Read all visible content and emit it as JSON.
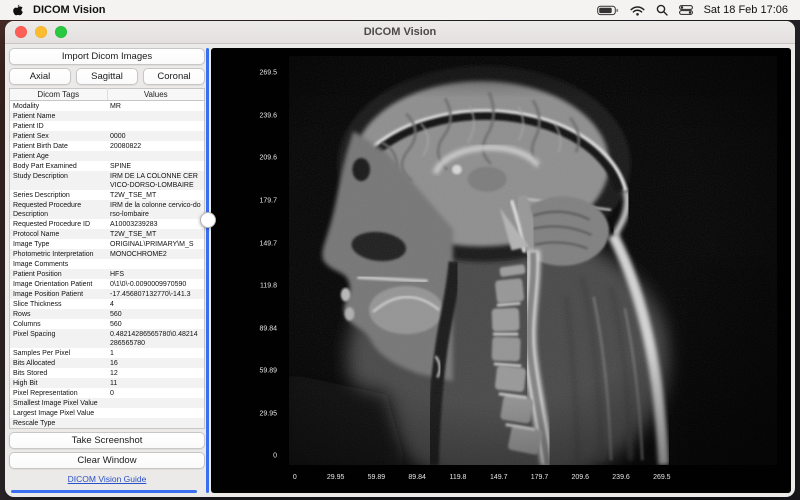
{
  "ui_colors": {
    "accent": "#3a6ff0",
    "link": "#2850c8",
    "viewer_bg": "#000000"
  },
  "menu_bar": {
    "app_name": "DICOM Vision",
    "clock": "Sat 18 Feb 17:06"
  },
  "window": {
    "title": "DICOM Vision"
  },
  "sidebar": {
    "import_button": "Import Dicom Images",
    "view_buttons": [
      "Axial",
      "Sagittal",
      "Coronal"
    ],
    "table": {
      "headers": [
        "Dicom Tags",
        "Values"
      ],
      "rows": [
        {
          "tag": "Modality",
          "value": "MR"
        },
        {
          "tag": "Patient Name",
          "value": ""
        },
        {
          "tag": "Patient ID",
          "value": ""
        },
        {
          "tag": "Patient Sex",
          "value": "0000"
        },
        {
          "tag": "Patient Birth Date",
          "value": "20080822"
        },
        {
          "tag": "Patient Age",
          "value": ""
        },
        {
          "tag": "Body Part Examined",
          "value": "SPINE"
        },
        {
          "tag": "Study Description",
          "value": "IRM DE LA COLONNE CERVICO-DORSO-LOMBAIRE"
        },
        {
          "tag": "Series Description",
          "value": "T2W_TSE_MT"
        },
        {
          "tag": "Requested Procedure Description",
          "value": "IRM de la colonne cervico-dorso-lombaire"
        },
        {
          "tag": "Requested Procedure ID",
          "value": "A10003239283"
        },
        {
          "tag": "Protocol Name",
          "value": "T2W_TSE_MT"
        },
        {
          "tag": "Image Type",
          "value": "ORIGINAL\\PRIMARY\\M_S"
        },
        {
          "tag": "Photometric Interpretation",
          "value": "MONOCHROME2"
        },
        {
          "tag": "Image Comments",
          "value": ""
        },
        {
          "tag": "Patient Position",
          "value": "HFS"
        },
        {
          "tag": "Image Orientation Patient",
          "value": "0\\1\\0\\-0.0090009970590"
        },
        {
          "tag": "Image Position Patient",
          "value": "-17.456807132770\\-141.3"
        },
        {
          "tag": "Slice Thickness",
          "value": "4"
        },
        {
          "tag": "Rows",
          "value": "560"
        },
        {
          "tag": "Columns",
          "value": "560"
        },
        {
          "tag": "Pixel Spacing",
          "value": "0.48214286565780\\0.48214286565780"
        },
        {
          "tag": "Samples Per Pixel",
          "value": "1"
        },
        {
          "tag": "Bits Allocated",
          "value": "16"
        },
        {
          "tag": "Bits Stored",
          "value": "12"
        },
        {
          "tag": "High Bit",
          "value": "11"
        },
        {
          "tag": "Pixel Representation",
          "value": "0"
        },
        {
          "tag": "Smallest Image Pixel Value",
          "value": ""
        },
        {
          "tag": "Largest Image Pixel Value",
          "value": ""
        },
        {
          "tag": "Rescale Type",
          "value": ""
        }
      ]
    },
    "screenshot_button": "Take Screenshot",
    "clear_button": "Clear Window",
    "guide_link": "DICOM Vision Guide"
  },
  "viewer": {
    "image_description": "Sagittal T2 MRI of head and cervical spine",
    "x_ticks": [
      "0",
      "29.95",
      "59.89",
      "89.84",
      "119.8",
      "149.7",
      "179.7",
      "209.6",
      "239.6",
      "269.5"
    ],
    "y_ticks": [
      "269.5",
      "239.6",
      "209.6",
      "179.7",
      "149.7",
      "119.8",
      "89.84",
      "59.89",
      "29.95",
      "0"
    ]
  }
}
